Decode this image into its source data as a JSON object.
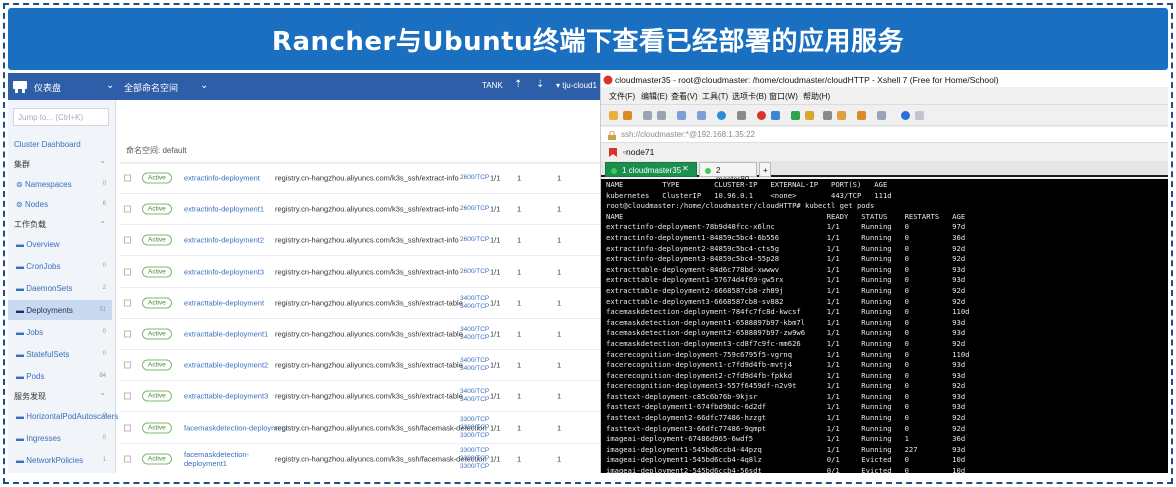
{
  "banner": {
    "title": "Rancher与Ubuntu终端下查看已经部署的应用服务"
  },
  "rancher": {
    "top": {
      "dashboard": "仪表盘",
      "namespace_select": "全部命名空间",
      "tank": "TANK",
      "cluster": "tju-cloud1"
    },
    "sidebar": {
      "jump_placeholder": "Jump to... (Ctrl+K)",
      "items": [
        {
          "label": "Cluster Dashboard",
          "count": ""
        },
        {
          "label": "集群",
          "count": ""
        },
        {
          "label": "Namespaces",
          "count": "0"
        },
        {
          "label": "Nodes",
          "count": "6"
        },
        {
          "label": "工作负载",
          "count": ""
        },
        {
          "label": "Overview",
          "count": ""
        },
        {
          "label": "CronJobs",
          "count": "0"
        },
        {
          "label": "DaemonSets",
          "count": "2"
        },
        {
          "label": "Deployments",
          "count": "51"
        },
        {
          "label": "Jobs",
          "count": "0"
        },
        {
          "label": "StatefulSets",
          "count": "0"
        },
        {
          "label": "Pods",
          "count": "84"
        },
        {
          "label": "服务发现",
          "count": ""
        },
        {
          "label": "HorizontalPodAutoscalers",
          "count": "0"
        },
        {
          "label": "Ingresses",
          "count": "0"
        },
        {
          "label": "NetworkPolicies",
          "count": "1"
        }
      ]
    },
    "namespace_label": "命名空间:  default",
    "rows": [
      {
        "status": "Active",
        "name": "extractinfo-deployment",
        "image": "registry.cn-hangzhou.aliyuncs.com/k3s_ssh/extract-info",
        "ports": "2600/TCP",
        "ready": "1/1",
        "up": "1",
        "restarts": "1"
      },
      {
        "status": "Active",
        "name": "extractinfo-deployment1",
        "image": "registry.cn-hangzhou.aliyuncs.com/k3s_ssh/extract-info",
        "ports": "2600/TCP",
        "ready": "1/1",
        "up": "1",
        "restarts": "1"
      },
      {
        "status": "Active",
        "name": "extractinfo-deployment2",
        "image": "registry.cn-hangzhou.aliyuncs.com/k3s_ssh/extract-info",
        "ports": "2600/TCP",
        "ready": "1/1",
        "up": "1",
        "restarts": "1"
      },
      {
        "status": "Active",
        "name": "extractinfo-deployment3",
        "image": "registry.cn-hangzhou.aliyuncs.com/k3s_ssh/extract-info",
        "ports": "2600/TCP",
        "ready": "1/1",
        "up": "1",
        "restarts": "1"
      },
      {
        "status": "Active",
        "name": "extracttable-deployment",
        "image": "registry.cn-hangzhou.aliyuncs.com/k3s_ssh/extract-table",
        "ports": "3400/TCP\n3400/TCP",
        "ready": "1/1",
        "up": "1",
        "restarts": "1"
      },
      {
        "status": "Active",
        "name": "extracttable-deployment1",
        "image": "registry.cn-hangzhou.aliyuncs.com/k3s_ssh/extract-table",
        "ports": "3400/TCP\n3400/TCP",
        "ready": "1/1",
        "up": "1",
        "restarts": "1"
      },
      {
        "status": "Active",
        "name": "extracttable-deployment2",
        "image": "registry.cn-hangzhou.aliyuncs.com/k3s_ssh/extract-table",
        "ports": "3400/TCP\n3400/TCP",
        "ready": "1/1",
        "up": "1",
        "restarts": "1"
      },
      {
        "status": "Active",
        "name": "extracttable-deployment3",
        "image": "registry.cn-hangzhou.aliyuncs.com/k3s_ssh/extract-table",
        "ports": "3400/TCP\n3400/TCP",
        "ready": "1/1",
        "up": "1",
        "restarts": "1"
      },
      {
        "status": "Active",
        "name": "facemaskdetection-deployment",
        "image": "registry.cn-hangzhou.aliyuncs.com/k3s_ssh/facemask-detection",
        "ports": "3300/TCP\n3300/TCP\n3300/TCP",
        "ready": "1/1",
        "up": "1",
        "restarts": "1"
      },
      {
        "status": "Active",
        "name": "facemaskdetection-\ndeployment1",
        "image": "registry.cn-hangzhou.aliyuncs.com/k3s_ssh/facemask-detection",
        "ports": "3300/TCP\n3300/TCP\n3300/TCP",
        "ready": "1/1",
        "up": "1",
        "restarts": "1"
      }
    ]
  },
  "xshell": {
    "window_title": "cloudmaster35 - root@cloudmaster: /home/cloudmaster/cloudHTTP - Xshell 7 (Free for Home/School)",
    "menu": [
      "文件(F)",
      "编辑(E)",
      "查看(V)",
      "工具(T)",
      "选项卡(B)",
      "窗口(W)",
      "帮助(H)"
    ],
    "address": "ssh://cloudmaster:*@192.168.1.35:22",
    "session": "node71",
    "tabs": [
      {
        "label": "1 cloudmaster35"
      },
      {
        "label": "2 master80"
      }
    ],
    "new_tab": "+",
    "terminal": [
      "NAME         TYPE        CLUSTER-IP   EXTERNAL-IP   PORT(S)   AGE",
      "kubernetes   ClusterIP   10.96.0.1    <none>        443/TCP   111d",
      "root@cloudmaster:/home/cloudmaster/cloudHTTP# kubectl get pods",
      "NAME                                               READY   STATUS    RESTARTS   AGE",
      "extractinfo-deployment-78b9d48fcc-x6lnc            1/1     Running   0          97d",
      "extractinfo-deployment1-84859c5bc4-6b556           1/1     Running   0          36d",
      "extractinfo-deployment2-84859c5bc4-cts5g           1/1     Running   0          92d",
      "extractinfo-deployment3-84859c5bc4-55p28           1/1     Running   0          92d",
      "extracttable-deployment-84d6c778bd-xwwwv           1/1     Running   0          93d",
      "extracttable-deployment1-57674d4f69-gw5rx          1/1     Running   0          93d",
      "extracttable-deployment2-6668587cb8-zh89j          1/1     Running   0          92d",
      "extracttable-deployment3-6668587cb8-sv882          1/1     Running   0          92d",
      "facemaskdetection-deployment-784fc7fc8d-kwcsf      1/1     Running   0          110d",
      "facemaskdetection-deployment1-6588897b97-kbm7l     1/1     Running   0          93d",
      "facemaskdetection-deployment2-6588897b97-zw9w6     1/1     Running   0          93d",
      "facemaskdetection-deployment3-cd8f7c9fc-mm626      1/1     Running   0          92d",
      "facerecognition-deployment-759c6795f5-vgrnq        1/1     Running   0          110d",
      "facerecognition-deployment1-c7fd9d4fb-mvtj4        1/1     Running   0          93d",
      "facerecognition-deployment2-c7fd9d4fb-fpkkd        1/1     Running   0          93d",
      "facerecognition-deployment3-557f6459df-n2v9t       1/1     Running   0          92d",
      "fasttext-deployment-c85c6b76b-9kjsr                1/1     Running   0          93d",
      "fasttext-deployment1-674fbd9bdc-6d2df              1/1     Running   0          93d",
      "fasttext-deployment2-66dfc77486-hzzgt              1/1     Running   0          92d",
      "fasttext-deployment3-66dfc77486-9qmpt              1/1     Running   0          92d",
      "imageai-deployment-67486d965-6wdf5                 1/1     Running   1          36d",
      "imageai-deployment1-545bd6ccb4-44pzq               1/1     Running   227        93d",
      "imageai-deployment1-545bd6ccb4-4q8lz               0/1     Evicted   0          10d",
      "imageai-deployment2-545bd6ccb4-56sdt               0/1     Evicted   0          10d"
    ]
  },
  "colors": {
    "banner": "#1a6fc0",
    "rancher_header": "#2f5ea8",
    "active_tab": "#1a8f4e",
    "terminal_bg": "#000000"
  }
}
